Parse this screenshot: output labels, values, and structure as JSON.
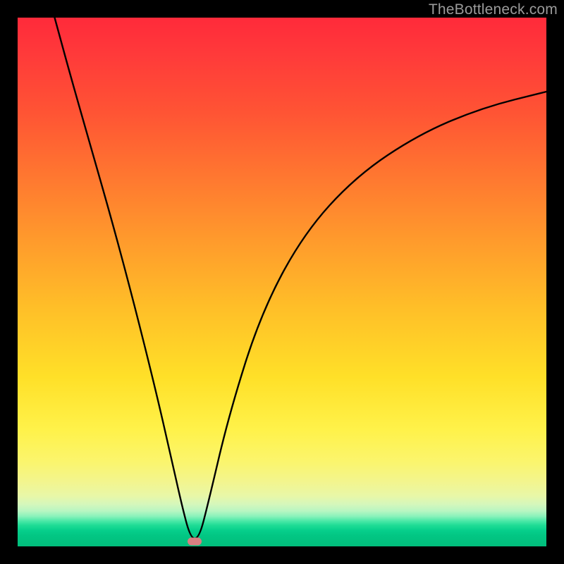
{
  "watermark": "TheBottleneck.com",
  "chart_data": {
    "type": "line",
    "title": "",
    "xlabel": "",
    "ylabel": "",
    "xlim": [
      0,
      100
    ],
    "ylim": [
      0,
      100
    ],
    "grid": false,
    "series": [
      {
        "name": "bottleneck-curve",
        "x": [
          7,
          10,
          14,
          18,
          22,
          26,
          29,
          31,
          32.7,
          34.3,
          36,
          40,
          46,
          54,
          64,
          76,
          88,
          100
        ],
        "y": [
          100,
          89,
          75,
          61,
          46,
          30,
          17,
          8,
          1.5,
          1.5,
          8,
          25,
          44,
          59,
          70,
          78,
          83,
          86
        ]
      }
    ],
    "marker": {
      "x": 33.5,
      "y": 1.0,
      "color": "#d97f82"
    },
    "background_gradient": {
      "top": "#ff2a3a",
      "mid": "#ffe028",
      "bottom": "#01be7c"
    }
  }
}
